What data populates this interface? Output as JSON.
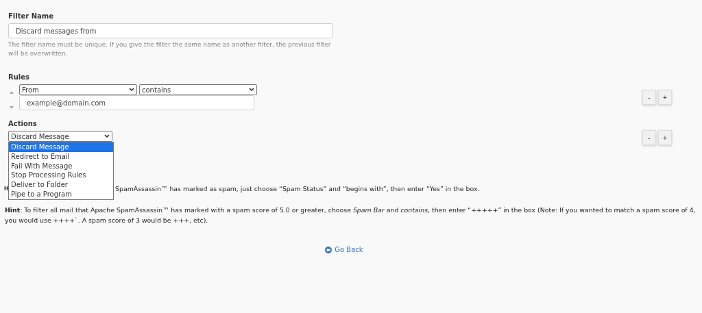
{
  "filter_name": {
    "label": "Filter Name",
    "value": "Discard messages from",
    "help": "The filter name must be unique. If you give the filter the same name as another filter, the previous filter will be overwritten."
  },
  "rules": {
    "label": "Rules",
    "field": "From",
    "operator": "contains",
    "value": "example@domain.com",
    "buttons": [
      "-",
      "+"
    ]
  },
  "actions": {
    "label": "Actions",
    "value": "Discard Message",
    "open": true,
    "options": [
      {
        "label": "Discard Message",
        "selected": true
      },
      {
        "label": "Redirect to Email",
        "selected": false
      },
      {
        "label": "Fail With Message",
        "selected": false
      },
      {
        "label": "Stop Processing Rules",
        "selected": false
      },
      {
        "label": "Deliver to Folder",
        "selected": false
      },
      {
        "label": "Pipe to a Program",
        "selected": false
      }
    ],
    "buttons": [
      "-",
      "+"
    ]
  },
  "hints": [
    {
      "lead": "H",
      "text": "SpamAssassin™ has marked as spam, just choose “Spam Status” and “begins with”, then enter “Yes” in the box."
    },
    {
      "text": "**Hint**: To filter all mail that Apache SpamAssassin™ has marked with a spam score of 5.0 or greater, choose *Spam Bar* and *contains*, then enter “+++++” in the box (Note: If you wanted to match a spam score of 4, you would use ++++`. A spam score of 3 would be +++, etc)."
    }
  ],
  "go_back": "Go Back"
}
